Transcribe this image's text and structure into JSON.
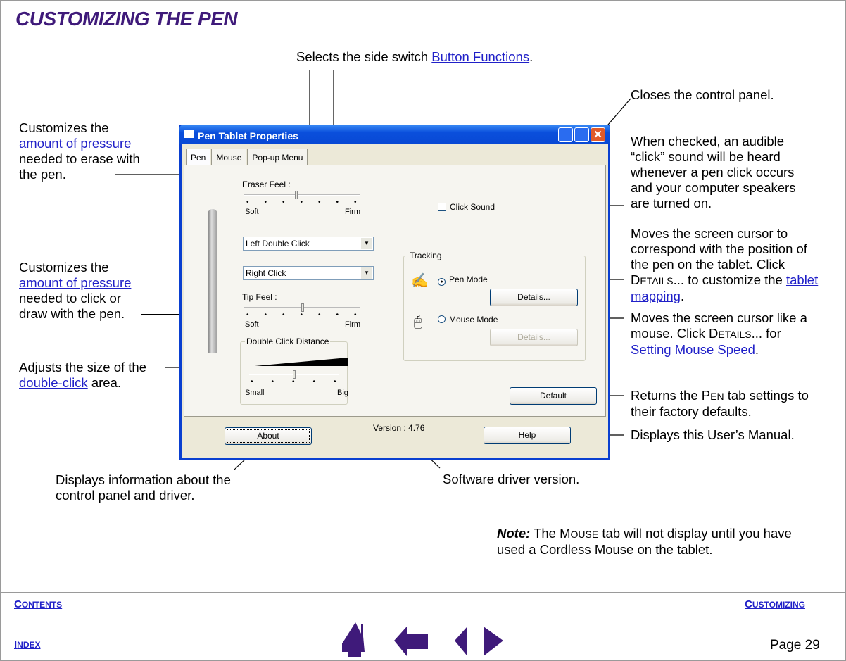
{
  "page_title": "CUSTOMIZING THE PEN",
  "annotations": {
    "side_switch": {
      "text": "Selects the side switch ",
      "link": "Button Functions",
      "suffix": "."
    },
    "close": "Closes the control panel.",
    "eraser": {
      "pre": "Customizes the",
      "link": "amount of pressure",
      "post": "needed to erase with the pen."
    },
    "tip": {
      "pre": "Customizes the",
      "link": "amount of pressure",
      "post": "needed to click or draw with the pen."
    },
    "double_click": {
      "pre": "Adjusts the size of the",
      "link": "double-click",
      "post": " area."
    },
    "click_sound": "When checked, an audible “click” sound will be heard whenever a pen click occurs and your computer speakers are turned on.",
    "pen_mode": {
      "pre": "Moves the screen cursor to correspond with the position of the pen on the tablet. Click ",
      "sc1": "D",
      "sc2": "ETAILS",
      "mid": "... to customize the ",
      "link": "tablet mapping",
      "post": "."
    },
    "mouse_mode": {
      "pre": "Moves the screen cursor like a mouse.  Click ",
      "sc1": "D",
      "sc2": "ETAILS",
      "mid": "... for ",
      "link": "Setting Mouse Speed",
      "post": "."
    },
    "default": {
      "pre": "Returns the P",
      "sc": "EN",
      "post": " tab settings to their factory defaults."
    },
    "help": "Displays this User’s Manual.",
    "about": "Displays information about the control panel and driver.",
    "version": "Software driver version.",
    "note": {
      "label": "Note:",
      "pre": " The M",
      "sc": "OUSE",
      "post": " tab will not display until you have used a Cordless Mouse on the tablet."
    }
  },
  "dialog": {
    "title": "Pen Tablet Properties",
    "tabs": [
      "Pen",
      "Mouse",
      "Pop-up Menu"
    ],
    "eraser_feel": "Eraser Feel :",
    "soft": "Soft",
    "firm": "Firm",
    "eraser_feel_value": 0.45,
    "upper_switch": "Left Double Click",
    "lower_switch": "Right Click",
    "tip_feel": "Tip Feel :",
    "tip_feel_value": 0.5,
    "double_click_distance": "Double Click Distance",
    "small": "Small",
    "big": "Big",
    "double_click_value": 0.5,
    "click_sound": "Click Sound",
    "click_sound_checked": false,
    "tracking": "Tracking",
    "pen_mode": "Pen Mode",
    "mouse_mode": "Mouse Mode",
    "tracking_selected": "Pen Mode",
    "details": "Details...",
    "default": "Default",
    "about": "About",
    "version": "Version : 4.76",
    "help": "Help"
  },
  "footer": {
    "contents": [
      "C",
      "ONTENTS"
    ],
    "customizing": [
      "C",
      "USTOMIZING"
    ],
    "index": [
      "I",
      "NDEX"
    ],
    "page": "Page  29"
  },
  "colors": {
    "title": "#3f1a7a",
    "link": "#2020c8",
    "nav_icons": "#3f1a7a"
  }
}
